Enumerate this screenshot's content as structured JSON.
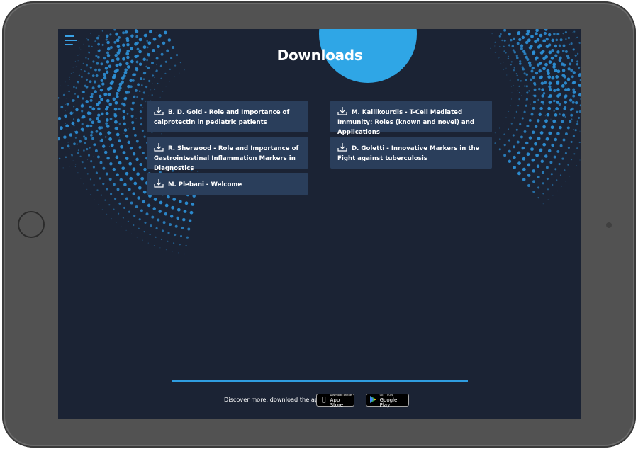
{
  "header": {
    "title": "Downloads"
  },
  "downloads": [
    {
      "label": "B. D. Gold - Role and Importance of calprotectin in pediatric patients"
    },
    {
      "label": "R. Sherwood - Role and Importance of Gastrointestinal Inflammation Markers in Diagnostics"
    },
    {
      "label": "M. Plebani - Welcome"
    },
    {
      "label": "M. Kallikourdis - T-Cell Mediated Immunity: Roles (known and novel) and Applications"
    },
    {
      "label": "D. Goletti - Innovative Markers in the Fight against tuberculosis"
    }
  ],
  "footer": {
    "text": "Discover more, download the app",
    "app_store_small": "Download on the",
    "app_store_big": "App Store",
    "google_play_small": "GET IT ON",
    "google_play_big": "Google Play"
  },
  "icons": {
    "menu": "menu-icon",
    "download": "download-icon",
    "apple": "apple-icon",
    "play": "google-play-icon"
  },
  "colors": {
    "screen_bg": "#1b2334",
    "card_bg": "#2a3e5b",
    "accent": "#2fa6e6",
    "device": "#525252"
  }
}
